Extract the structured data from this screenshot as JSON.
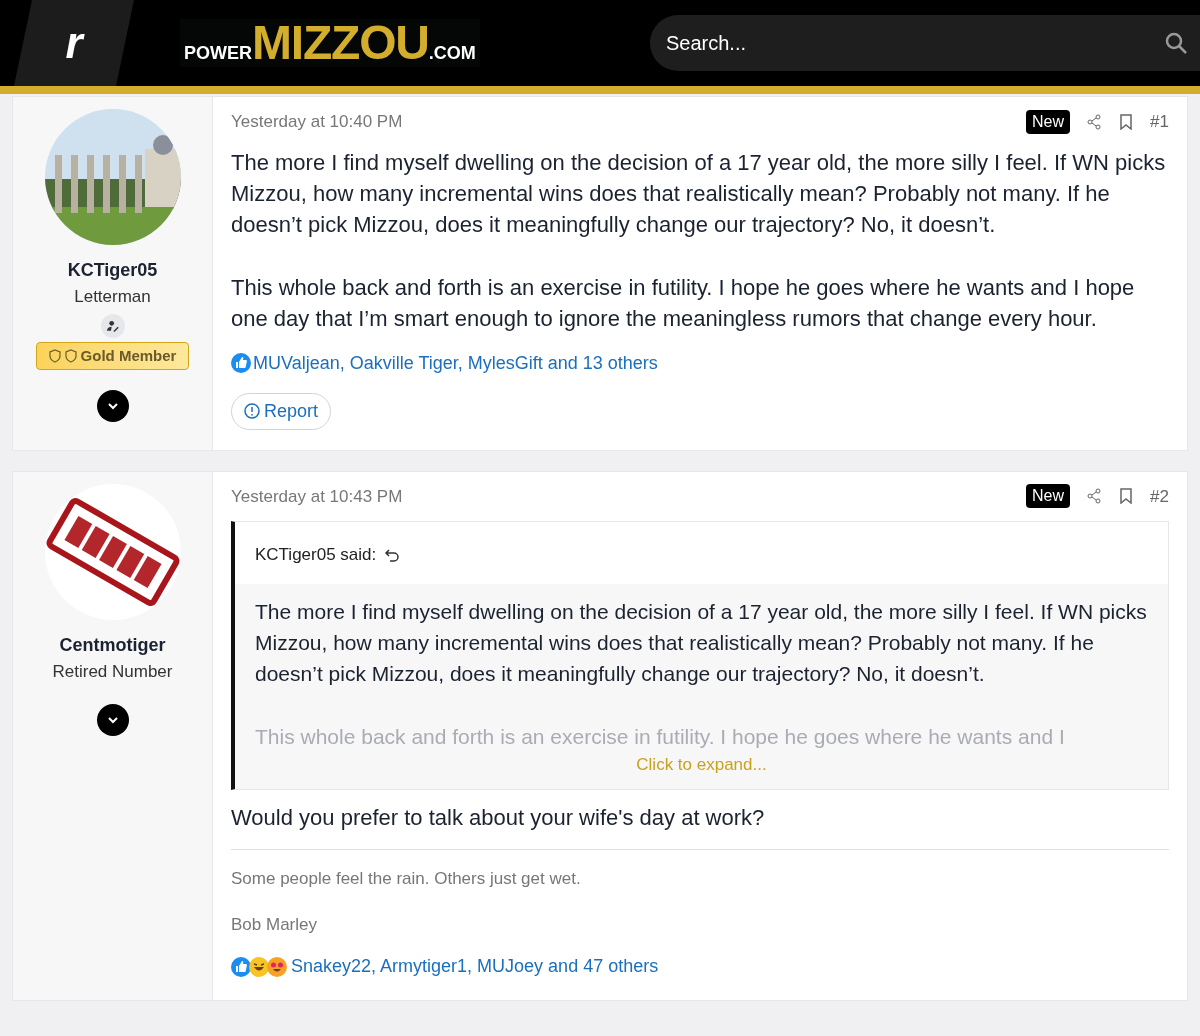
{
  "header": {
    "site_mark": "r",
    "logo": {
      "prefix": "POWER",
      "main": "MIZZOU",
      "suffix": ".COM"
    },
    "search": {
      "placeholder": "Search..."
    }
  },
  "posts": [
    {
      "author": {
        "name": "KCTiger05",
        "title": "Letterman",
        "badge": "Gold Member",
        "editor_icon": true
      },
      "time": "Yesterday at 10:40 PM",
      "new_label": "New",
      "number": "#1",
      "paragraphs": [
        "The more I find myself dwelling on the decision of a 17 year old, the more silly I feel. If WN picks Mizzou, how many incremental wins does that realistically mean? Probably not many. If he doesn’t pick Mizzou, does it meaningfully change our trajectory? No, it doesn’t.",
        "This whole back and forth is an exercise in futility. I hope he goes where he wants and I hope one day that I’m smart enough to ignore the meaningless rumors that change every hour."
      ],
      "reactions": [
        {
          "kind": "like"
        }
      ],
      "reaction_text": "MUValjean, Oakville Tiger, MylesGift and 13 others",
      "report": "Report"
    },
    {
      "author": {
        "name": "Centmotiger",
        "title": "Retired Number"
      },
      "time": "Yesterday at 10:43 PM",
      "new_label": "New",
      "number": "#2",
      "quote": {
        "attribution": "KCTiger05 said:",
        "paragraphs": [
          "The more I find myself dwelling on the decision of a 17 year old, the more silly I feel. If WN picks Mizzou, how many incremental wins does that realistically mean? Probably not many. If he doesn’t pick Mizzou, does it meaningfully change our trajectory? No, it doesn’t."
        ],
        "faded": "This whole back and forth is an exercise in futility. I hope he goes where he wants and I",
        "expand": "Click to expand..."
      },
      "paragraphs": [
        "Would you prefer to talk about your wife's day at work?"
      ],
      "signature": [
        "Some people feel the rain. Others just get wet.",
        "Bob Marley"
      ],
      "reactions": [
        {
          "kind": "like"
        },
        {
          "kind": "laugh"
        },
        {
          "kind": "love"
        }
      ],
      "reaction_text": "Snakey22, Armytiger1, MUJoey and 47 others"
    }
  ]
}
